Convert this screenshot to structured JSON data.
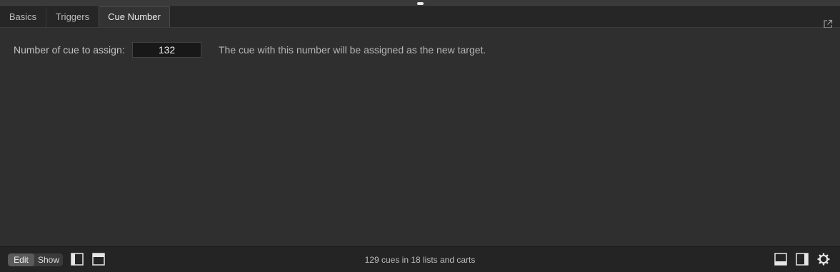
{
  "tabs": [
    {
      "label": "Basics",
      "active": false
    },
    {
      "label": "Triggers",
      "active": false
    },
    {
      "label": "Cue Number",
      "active": true
    }
  ],
  "popout_icon": "external-window-icon",
  "cue_number": {
    "label": "Number of cue to assign:",
    "value": "132",
    "help": "The cue with this number will be assigned as the new target."
  },
  "footer": {
    "edit_label": "Edit",
    "show_label": "Show",
    "active_mode": "Edit",
    "status": "129 cues in 18 lists and carts",
    "left_icons": [
      "left-sidebar-icon",
      "top-panel-icon"
    ],
    "right_icons": [
      "bottom-panel-icon",
      "right-sidebar-icon",
      "gear-icon"
    ]
  },
  "colors": {
    "background": "#2f2f2f",
    "tab_bar": "#262626",
    "input_background": "#181818",
    "text": "#c2c2c2"
  }
}
